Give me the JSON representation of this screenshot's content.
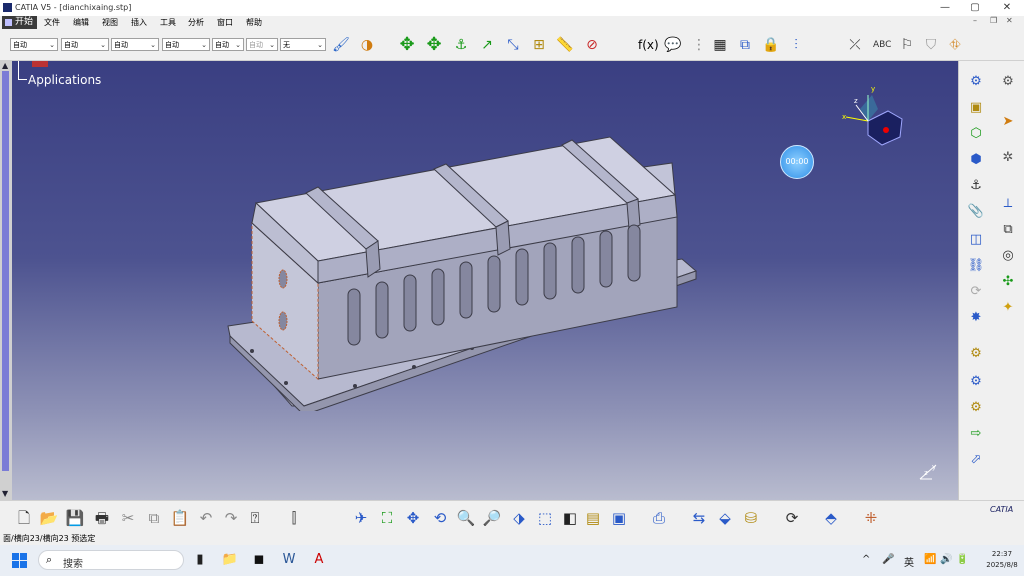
{
  "window": {
    "title": "CATIA V5 - [dianchixaing.stp]",
    "controls": {
      "minimize": "—",
      "maximize": "▢",
      "close": "✕"
    },
    "inner_controls": {
      "minimize": "–",
      "restore": "❐",
      "close": "✕"
    }
  },
  "menu": {
    "start": "开始",
    "items": [
      "文件",
      "编辑",
      "视图",
      "插入",
      "工具",
      "分析",
      "窗口",
      "帮助"
    ]
  },
  "toolbar": {
    "combos": [
      {
        "value": "自动",
        "disabled": false
      },
      {
        "value": "自动",
        "disabled": false
      },
      {
        "value": "自动",
        "disabled": false
      },
      {
        "value": "自动",
        "disabled": false
      },
      {
        "value": "自动",
        "disabled": false
      },
      {
        "value": "自动",
        "disabled": true
      },
      {
        "value": "无",
        "disabled": false
      }
    ],
    "icons": [
      "paint-brush-icon",
      "material-icon",
      "pan-icon",
      "fly-icon",
      "snap-icon",
      "measure-icon",
      "line-icon",
      "dimension-icon",
      "ruler-icon",
      "measure-item-icon",
      "formula-icon",
      "comment-icon",
      "knowledge-icon",
      "table-icon",
      "parameters-icon",
      "lock-icon",
      "design-table-icon",
      "sketch-icon",
      "abc-text-icon",
      "flag-note-icon",
      "shield-icon",
      "catalog-icon"
    ]
  },
  "viewport": {
    "tree_label": "Applications",
    "timer": "00:00"
  },
  "bottom_toolbar": {
    "icons": [
      "new-icon",
      "open-icon",
      "save-icon",
      "print-icon",
      "cut-icon",
      "copy-icon",
      "paste-icon",
      "undo-icon",
      "redo-icon",
      "whats-this-icon",
      "graph-icon",
      "fly-mode-icon",
      "fit-all-icon",
      "pan-icon",
      "rotate-icon",
      "zoom-in-icon",
      "zoom-out-icon",
      "normal-view-icon",
      "iso-view-icon",
      "shading-icon",
      "hide-show-icon",
      "swap-icon",
      "capture-icon",
      "measure-between-icon",
      "compass-icon",
      "cylinder-icon",
      "sync-icon",
      "eraser-icon",
      "grid-icon"
    ]
  },
  "right_toolbar": {
    "icons": [
      "product-icon",
      "gears-icon",
      "part-icon",
      "move-icon",
      "assembly-icon",
      "cursor-icon",
      "explode-icon",
      "manipulate-icon",
      "constraint-icon",
      "clash-icon",
      "attach-icon",
      "section-icon",
      "bom-icon",
      "snapshot-icon",
      "link-icon",
      "reconnect-icon",
      "update-icon",
      "compass-icon",
      "sparkle-icon",
      "cog-1-icon",
      "cog-2-icon",
      "cog-3-icon",
      "export-icon",
      "publish-icon"
    ]
  },
  "status": {
    "text": "面/横向23/横向23 预选定"
  },
  "taskbar": {
    "search_placeholder": "搜索",
    "apps": [
      "file-explorer-icon",
      "folder-icon",
      "media-icon",
      "word-icon",
      "autocad-icon"
    ],
    "tray": [
      "^",
      "🎤",
      "英",
      "📶",
      "🔊",
      "🔋"
    ],
    "time": "22:37",
    "date": "2025/8/8"
  },
  "logo": "CATIA",
  "colors": {
    "viewport_top": "#3a3f82",
    "viewport_bottom": "#b9bccf",
    "model_fill": "#c9cade",
    "model_edge": "#3c3c48"
  }
}
